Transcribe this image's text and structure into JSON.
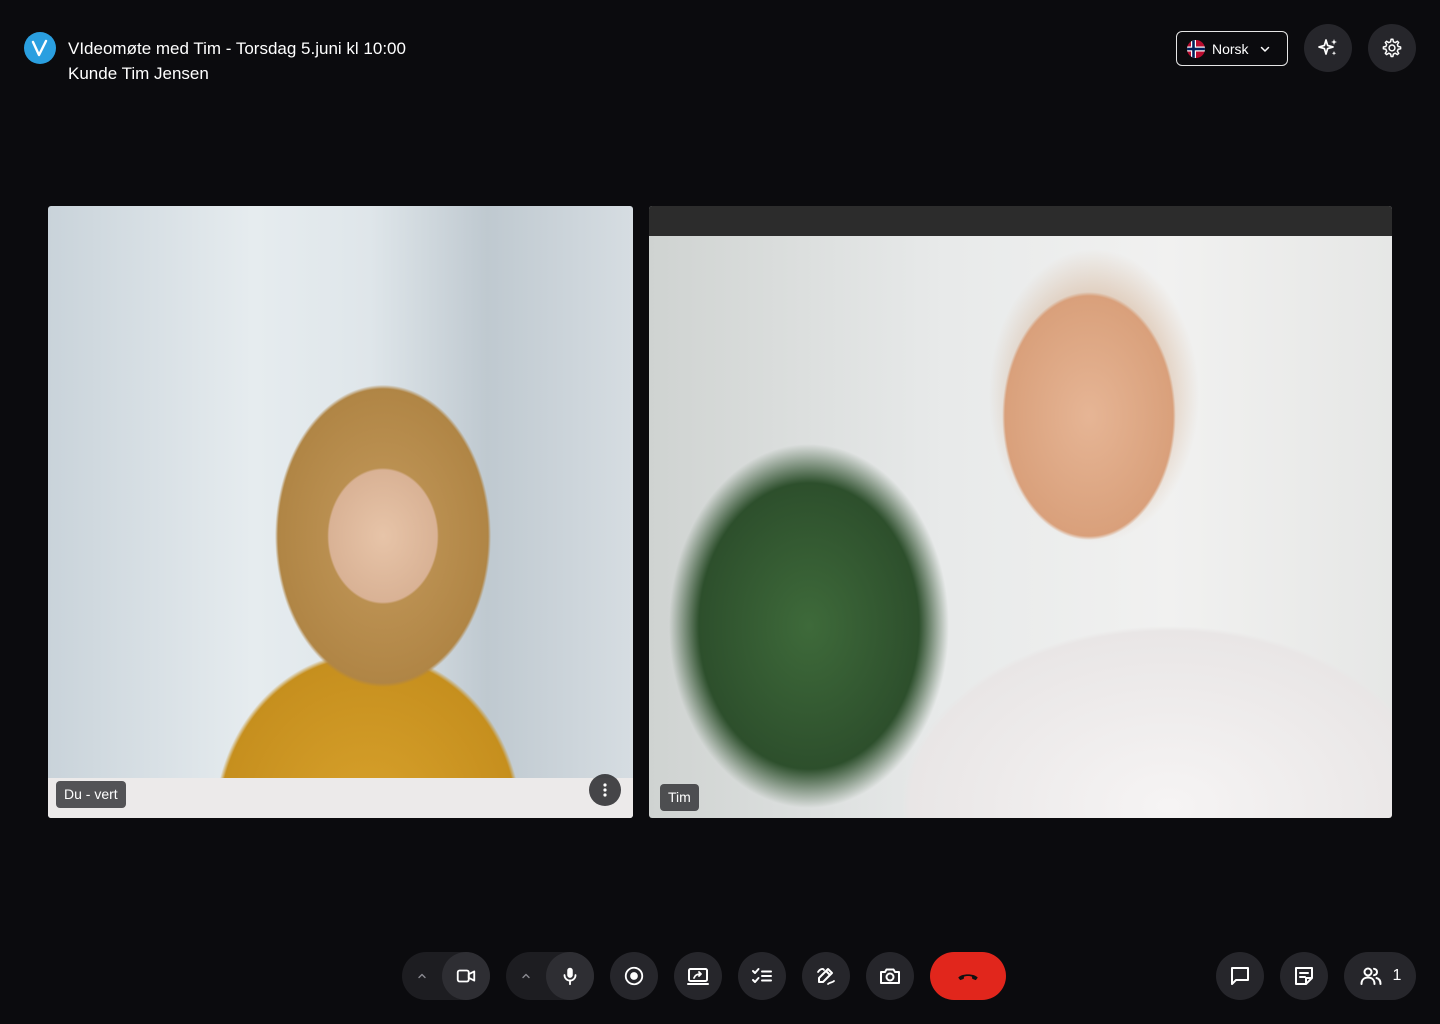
{
  "header": {
    "title": "VIdeomøte med Tim - Torsdag 5.juni kl 10:00",
    "subtitle": "Kunde Tim Jensen"
  },
  "language": {
    "selected": "Norsk"
  },
  "tiles": {
    "host": {
      "label": "Du - vert"
    },
    "guest": {
      "label": "Tim"
    }
  },
  "participants": {
    "count": "1"
  },
  "colors": {
    "background": "#0b0b0e",
    "accent": "#2a9fe0",
    "hangup": "#e1261c"
  },
  "icons": [
    "app-logo-icon",
    "norway-flag-icon",
    "chevron-down-icon",
    "ai-sparkle-icon",
    "settings-icon",
    "more-vertical-icon",
    "chevron-up-icon",
    "video-camera-icon",
    "microphone-icon",
    "record-icon",
    "share-screen-icon",
    "checklist-icon",
    "sign-icon",
    "camera-snapshot-icon",
    "hang-up-icon",
    "chat-icon",
    "notes-icon",
    "participants-icon"
  ]
}
